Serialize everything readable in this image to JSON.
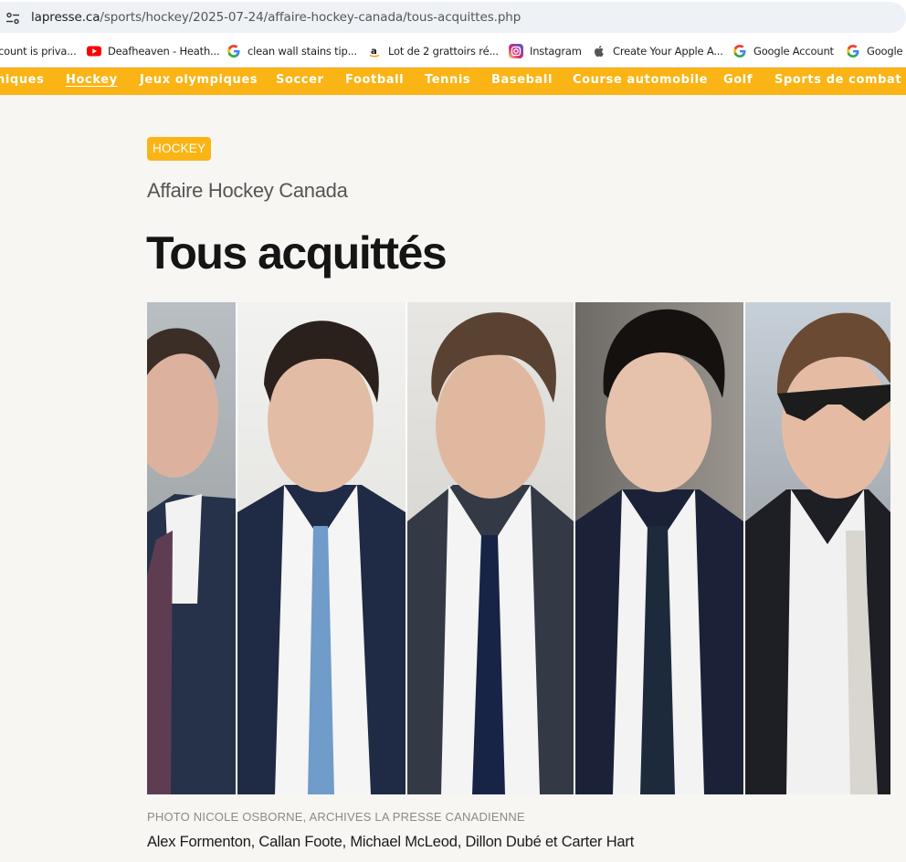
{
  "browser": {
    "url_host": "lapresse.ca",
    "url_path": "/sports/hockey/2025-07-24/affaire-hockey-canada/tous-acquittes.php"
  },
  "bookmarks": [
    {
      "label": "count is priva...",
      "icon": "none"
    },
    {
      "label": "Deafheaven - Heath...",
      "icon": "youtube-icon"
    },
    {
      "label": "clean wall stains tip...",
      "icon": "google-icon"
    },
    {
      "label": "Lot de 2 grattoirs ré...",
      "icon": "amazon-icon"
    },
    {
      "label": "Instagram",
      "icon": "instagram-icon"
    },
    {
      "label": "Create Your Apple A...",
      "icon": "apple-icon"
    },
    {
      "label": "Google Account",
      "icon": "google-icon"
    },
    {
      "label": "Google A",
      "icon": "google-icon"
    }
  ],
  "sports_nav": {
    "items": [
      "niques",
      "Hockey",
      "Jeux olympiques",
      "Soccer",
      "Football",
      "Tennis",
      "Baseball",
      "Course automobile",
      "Golf",
      "Sports de combat"
    ],
    "active": "Hockey",
    "color": "#fbb415"
  },
  "article": {
    "section_badge": "HOCKEY",
    "kicker": "Affaire Hockey Canada",
    "headline": "Tous acquittés",
    "photo_credit": "PHOTO NICOLE OSBORNE, ARCHIVES LA PRESSE CANADIENNE",
    "photo_caption": "Alex Formenton, Callan Foote, Michael McLeod, Dillon Dubé et Carter Hart"
  }
}
